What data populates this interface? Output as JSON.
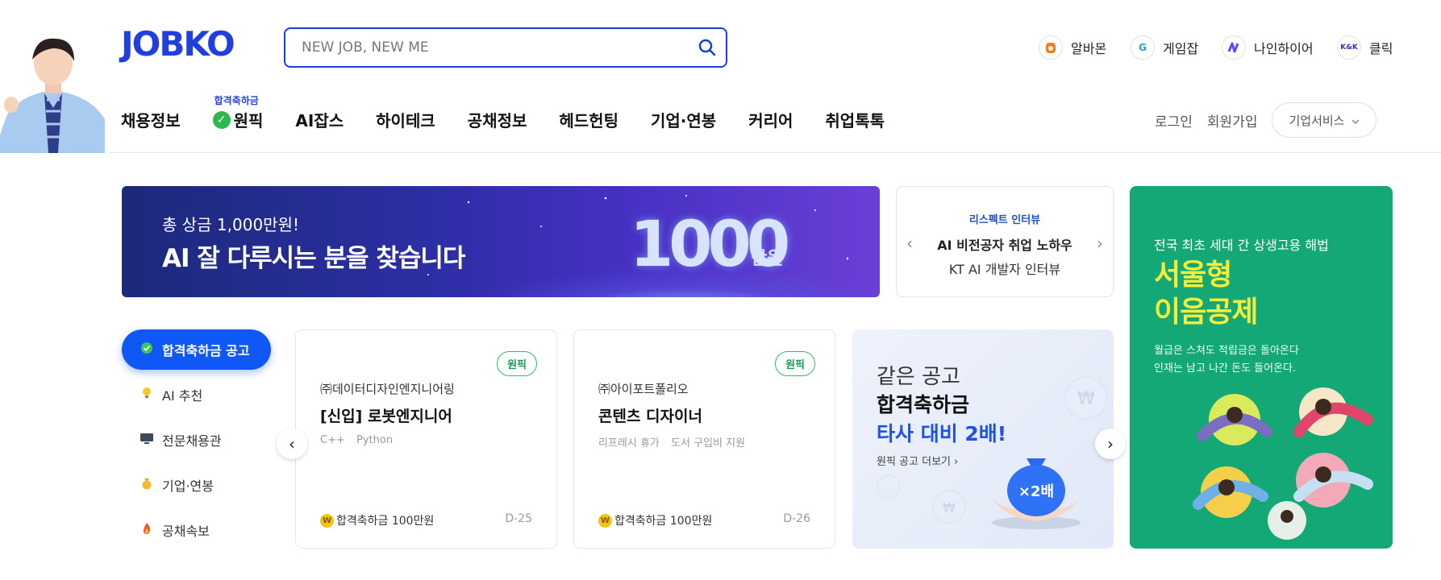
{
  "brand": {
    "logo": "JOBKO",
    "accent": "#1f3fe0"
  },
  "search": {
    "placeholder": "NEW JOB, NEW ME",
    "icon": "search-icon"
  },
  "family_sites": [
    {
      "label": "알바몬",
      "icon_text": "o",
      "color": "#ff6b00"
    },
    {
      "label": "게임잡",
      "icon_text": "G",
      "color": "#19a9c7"
    },
    {
      "label": "나인하이어",
      "icon_text": "N",
      "color": "#5b4bff"
    },
    {
      "label": "클릭",
      "icon_text": "K&K",
      "color": "#4b2bb8"
    }
  ],
  "gnb": {
    "items": [
      "채용정보",
      "원픽",
      "AI잡스",
      "하이테크",
      "공채정보",
      "헤드헌팅",
      "기업·연봉",
      "커리어",
      "취업톡톡"
    ],
    "onepick_badge": "합격축하금"
  },
  "util": {
    "login": "로그인",
    "signup": "회원가입",
    "corp_service": "기업서비스"
  },
  "hero": {
    "line1": "총 상금 1,000만원!",
    "line2": "AI 잘 다루시는 분을 찾습니다",
    "big_number": "1000",
    "unit": "만원"
  },
  "interview": {
    "tag": "리스펙트 인터뷰",
    "title": "AI 비전공자 취업 노하우",
    "subtitle": "KT AI 개발자 인터뷰"
  },
  "side_menu": [
    {
      "label": "합격축하금 공고",
      "icon": "check-icon",
      "active": true
    },
    {
      "label": "AI 추천",
      "icon": "lightbulb-icon",
      "active": false
    },
    {
      "label": "전문채용관",
      "icon": "monitor-icon",
      "active": false
    },
    {
      "label": "기업·연봉",
      "icon": "money-bag-icon",
      "active": false
    },
    {
      "label": "공채속보",
      "icon": "fire-icon",
      "active": false
    }
  ],
  "jobs": [
    {
      "pill": "원픽",
      "company": "㈜데이터디자인엔지니어링",
      "title": "[신입] 로봇엔지니어",
      "tags": [
        "C++",
        "Python"
      ],
      "bonus": "합격축하금 100만원",
      "dday": "D-25"
    },
    {
      "pill": "원픽",
      "company": "㈜아이포트폴리오",
      "title": "콘텐츠 디자이너",
      "tags": [
        "리프레시 휴가",
        "도서 구입비 지원"
      ],
      "bonus": "합격축하금 100만원",
      "dday": "D-26"
    }
  ],
  "promo": {
    "line1": "같은 공고",
    "line2": "합격축하금",
    "line3": "타사 대비 2배!",
    "more": "원픽 공고 더보기",
    "bag_label": "×2배"
  },
  "green_banner": {
    "sub": "전국 최초 세대 간 상생고용 해법",
    "headline1": "서울형",
    "headline2": "이음공제",
    "desc1": "월급은 스쳐도 적립금은 돌아온다",
    "desc2": "인재는 남고 나간 돈도 들어온다.",
    "bg": "#13a876",
    "headline_color": "#f4ee3a"
  }
}
